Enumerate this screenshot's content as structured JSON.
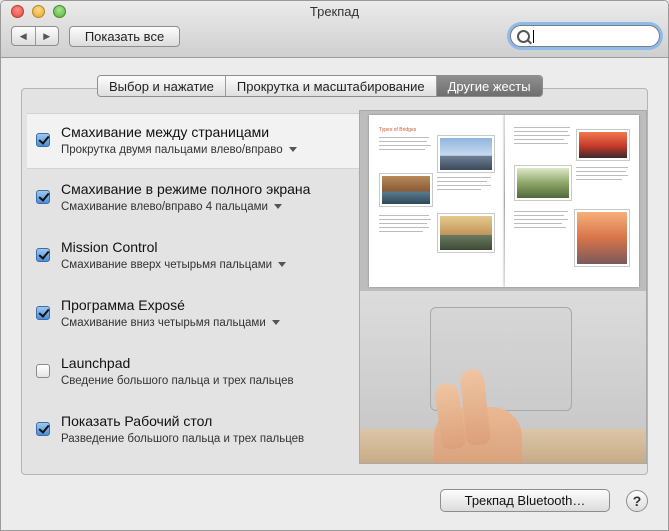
{
  "window": {
    "title": "Трекпад"
  },
  "toolbar": {
    "back_glyph": "◀",
    "forward_glyph": "▶",
    "show_all_label": "Показать все"
  },
  "search": {
    "value": "",
    "placeholder": ""
  },
  "tabs": [
    {
      "label": "Выбор и нажатие",
      "active": false
    },
    {
      "label": "Прокрутка и масштабирование",
      "active": false
    },
    {
      "label": "Другие жесты",
      "active": true
    }
  ],
  "gestures": [
    {
      "title": "Смахивание между страницами",
      "subtitle": "Прокрутка двумя пальцами влево/вправо",
      "checked": true,
      "has_menu": true
    },
    {
      "title": "Смахивание в режиме полного экрана",
      "subtitle": "Смахивание влево/вправо 4 пальцами",
      "checked": true,
      "has_menu": true
    },
    {
      "title": "Mission Control",
      "subtitle": "Смахивание вверх четырьмя пальцами",
      "checked": true,
      "has_menu": true
    },
    {
      "title": "Программа Exposé",
      "subtitle": "Смахивание вниз четырьмя пальцами",
      "checked": true,
      "has_menu": true
    },
    {
      "title": "Launchpad",
      "subtitle": "Сведение большого пальца и трех пальцев",
      "checked": false,
      "has_menu": false
    },
    {
      "title": "Показать Рабочий стол",
      "subtitle": "Разведение большого пальца и трех пальцев",
      "checked": true,
      "has_menu": false
    }
  ],
  "preview": {
    "page_title": "Types of Bridges"
  },
  "footer": {
    "bluetooth_label": "Трекпад Bluetooth…",
    "help_label": "?"
  },
  "colors": {
    "accent": "#4a8fd8",
    "tab_active": "#7a7a7a",
    "focus_ring": "#8ebbeb"
  }
}
